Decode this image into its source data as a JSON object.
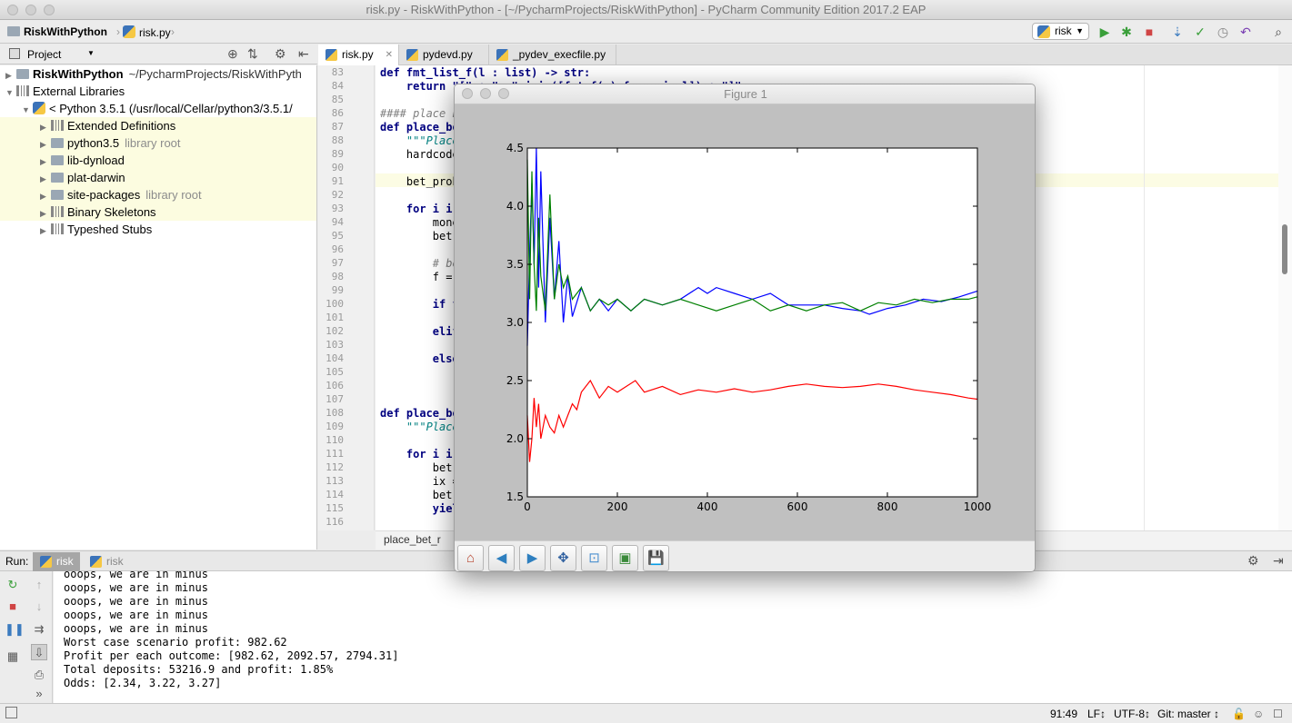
{
  "window": {
    "title": "risk.py - RiskWithPython - [~/PycharmProjects/RiskWithPython] - PyCharm Community Edition 2017.2 EAP"
  },
  "navbar": {
    "project_crumb": "RiskWithPython",
    "file_crumb": "risk.py",
    "run_config": "risk"
  },
  "project_panel": {
    "header": "Project",
    "tree": [
      {
        "label": "RiskWithPython",
        "hint": "~/PycharmProjects/RiskWithPyth"
      },
      {
        "label": "External Libraries",
        "hint": ""
      },
      {
        "label": "< Python 3.5.1 (/usr/local/Cellar/python3/3.5.1/",
        "hint": ""
      },
      {
        "label": "Extended Definitions",
        "hint": ""
      },
      {
        "label": "python3.5",
        "hint": "library root"
      },
      {
        "label": "lib-dynload",
        "hint": ""
      },
      {
        "label": "plat-darwin",
        "hint": ""
      },
      {
        "label": "site-packages",
        "hint": "library root"
      },
      {
        "label": "Binary Skeletons",
        "hint": ""
      },
      {
        "label": "Typeshed Stubs",
        "hint": ""
      }
    ]
  },
  "editor": {
    "tabs": [
      "risk.py",
      "pydevd.py",
      "_pydev_execfile.py"
    ],
    "lines": [
      {
        "n": "83",
        "code": "def fmt_list_f(l : list) -> str:"
      },
      {
        "n": "84",
        "code": "    return \"[\" + \", \".join([fmt_f(x) for x in l]) + \"]\""
      },
      {
        "n": "85",
        "code": ""
      },
      {
        "n": "86",
        "code": "#### place b"
      },
      {
        "n": "87",
        "code": "def place_be"
      },
      {
        "n": "88",
        "code": "    \"\"\"Place"
      },
      {
        "n": "89",
        "code": "    hardcode"
      },
      {
        "n": "90",
        "code": ""
      },
      {
        "n": "91",
        "code": "    bet_prob"
      },
      {
        "n": "92",
        "code": ""
      },
      {
        "n": "93",
        "code": "    for i ir"
      },
      {
        "n": "94",
        "code": "        mone"
      },
      {
        "n": "95",
        "code": "        bet"
      },
      {
        "n": "96",
        "code": ""
      },
      {
        "n": "97",
        "code": "        # be"
      },
      {
        "n": "98",
        "code": "        f ="
      },
      {
        "n": "99",
        "code": ""
      },
      {
        "n": "100",
        "code": "        if f"
      },
      {
        "n": "101",
        "code": ""
      },
      {
        "n": "102",
        "code": "        elif"
      },
      {
        "n": "103",
        "code": ""
      },
      {
        "n": "104",
        "code": "        else"
      },
      {
        "n": "105",
        "code": ""
      },
      {
        "n": "106",
        "code": ""
      },
      {
        "n": "107",
        "code": ""
      },
      {
        "n": "108",
        "code": "def place_be"
      },
      {
        "n": "109",
        "code": "    \"\"\"Place"
      },
      {
        "n": "110",
        "code": ""
      },
      {
        "n": "111",
        "code": "    for i ir"
      },
      {
        "n": "112",
        "code": "        bet"
      },
      {
        "n": "113",
        "code": "        ix ="
      },
      {
        "n": "114",
        "code": "        bet"
      },
      {
        "n": "115",
        "code": "        yiel"
      },
      {
        "n": "116",
        "code": ""
      }
    ],
    "breadcrumb": "place_bet_r"
  },
  "run_panel": {
    "label": "Run:",
    "tabs": [
      "risk",
      "risk"
    ],
    "output": [
      "ooops, we are in minus",
      "ooops, we are in minus",
      "ooops, we are in minus",
      "ooops, we are in minus",
      "ooops, we are in minus",
      "Worst case scenario profit: 982.62",
      "Profit per each outcome: [982.62, 2092.57, 2794.31]",
      "Total deposits: 53216.9 and profit: 1.85%",
      "Odds: [2.34, 3.22, 3.27]"
    ]
  },
  "statusbar": {
    "position": "91:49",
    "line_sep": "LF↕",
    "encoding": "UTF-8↕",
    "vcs": "Git: master ↕"
  },
  "figure": {
    "title": "Figure 1",
    "toolbar": [
      "home",
      "back",
      "forward",
      "pan",
      "zoom",
      "configure",
      "save"
    ]
  },
  "chart_data": {
    "type": "line",
    "title": "",
    "xlabel": "",
    "ylabel": "",
    "xlim": [
      0,
      1000
    ],
    "ylim": [
      1.5,
      4.5
    ],
    "xticks": [
      "0",
      "200",
      "400",
      "600",
      "800",
      "1000"
    ],
    "yticks": [
      "1.5",
      "2.0",
      "2.5",
      "3.0",
      "3.5",
      "4.0",
      "4.5"
    ],
    "grid": false,
    "series": [
      {
        "color": "#0000ff",
        "x": [
          0,
          5,
          10,
          15,
          20,
          25,
          30,
          40,
          50,
          60,
          70,
          80,
          90,
          100,
          120,
          140,
          160,
          180,
          200,
          230,
          260,
          300,
          340,
          380,
          400,
          420,
          460,
          500,
          540,
          580,
          620,
          660,
          700,
          740,
          760,
          800,
          840,
          880,
          920,
          960,
          1000
        ],
        "y": [
          2.8,
          3.6,
          4.2,
          3.5,
          4.5,
          3.3,
          4.3,
          3.0,
          3.9,
          3.2,
          3.7,
          3.0,
          3.4,
          3.05,
          3.3,
          3.1,
          3.2,
          3.1,
          3.2,
          3.1,
          3.2,
          3.15,
          3.2,
          3.3,
          3.25,
          3.3,
          3.25,
          3.2,
          3.25,
          3.15,
          3.15,
          3.15,
          3.12,
          3.1,
          3.07,
          3.12,
          3.15,
          3.2,
          3.18,
          3.22,
          3.27
        ]
      },
      {
        "color": "#008000",
        "x": [
          0,
          5,
          10,
          15,
          20,
          25,
          30,
          40,
          50,
          60,
          70,
          80,
          90,
          100,
          120,
          140,
          160,
          180,
          200,
          230,
          260,
          300,
          340,
          380,
          420,
          460,
          500,
          540,
          580,
          620,
          660,
          700,
          740,
          780,
          820,
          860,
          900,
          940,
          980,
          1000
        ],
        "y": [
          4.4,
          3.2,
          4.3,
          3.5,
          3.1,
          3.9,
          3.4,
          3.1,
          4.1,
          3.2,
          3.5,
          3.3,
          3.4,
          3.2,
          3.3,
          3.1,
          3.2,
          3.15,
          3.2,
          3.1,
          3.2,
          3.15,
          3.2,
          3.15,
          3.1,
          3.15,
          3.2,
          3.1,
          3.15,
          3.1,
          3.15,
          3.17,
          3.1,
          3.17,
          3.15,
          3.2,
          3.17,
          3.2,
          3.2,
          3.22
        ]
      },
      {
        "color": "#ff0000",
        "x": [
          0,
          5,
          10,
          15,
          20,
          25,
          30,
          40,
          50,
          60,
          70,
          80,
          90,
          100,
          110,
          120,
          140,
          160,
          180,
          200,
          220,
          240,
          260,
          300,
          340,
          380,
          420,
          460,
          500,
          540,
          580,
          620,
          660,
          700,
          740,
          780,
          820,
          860,
          900,
          940,
          980,
          1000
        ],
        "y": [
          2.2,
          1.8,
          2.0,
          2.35,
          2.1,
          2.3,
          2.0,
          2.2,
          2.1,
          2.05,
          2.2,
          2.1,
          2.2,
          2.3,
          2.25,
          2.4,
          2.5,
          2.35,
          2.45,
          2.4,
          2.45,
          2.5,
          2.4,
          2.45,
          2.38,
          2.42,
          2.4,
          2.43,
          2.4,
          2.42,
          2.45,
          2.47,
          2.45,
          2.44,
          2.45,
          2.47,
          2.45,
          2.42,
          2.4,
          2.38,
          2.35,
          2.34
        ]
      }
    ]
  }
}
